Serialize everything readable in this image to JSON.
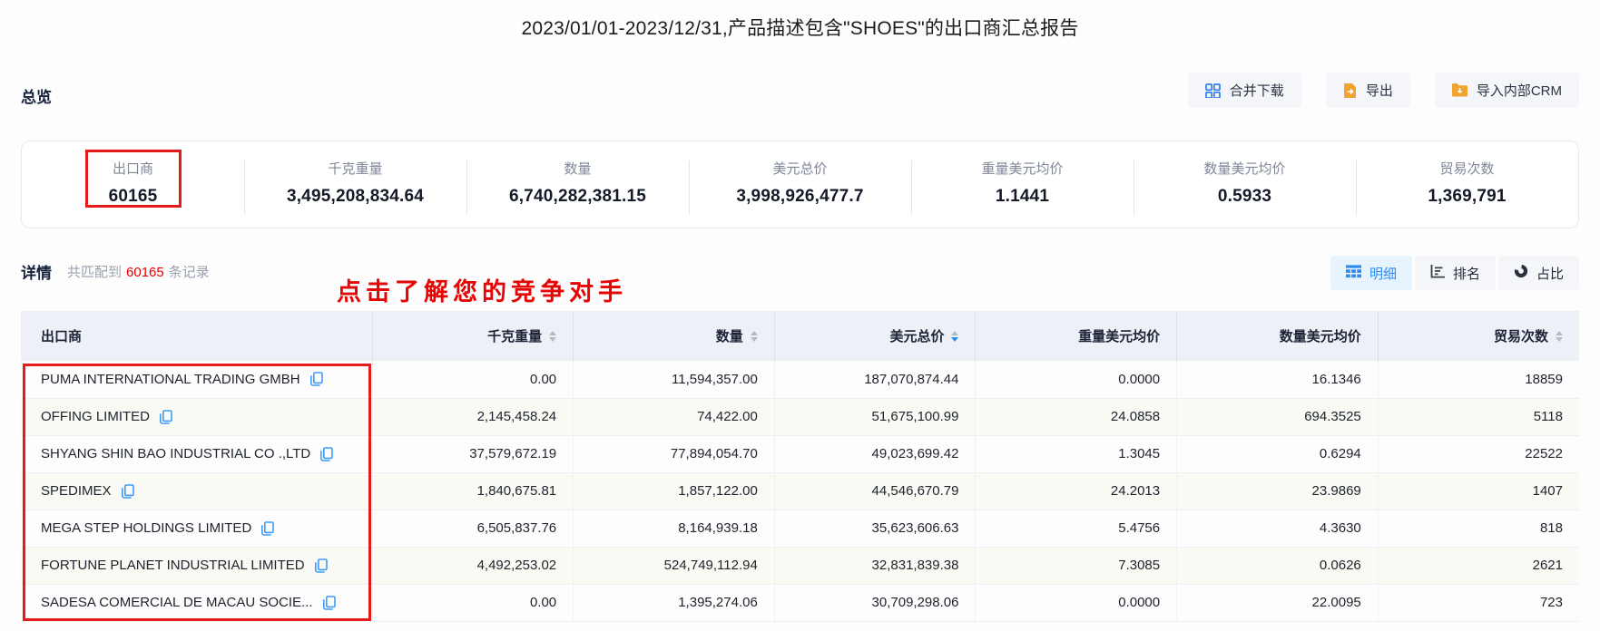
{
  "title": "2023/01/01-2023/12/31,产品描述包含\"SHOES\"的出口商汇总报告",
  "toolbar": {
    "merge_download": "合并下载",
    "export": "导出",
    "import_crm": "导入内部CRM"
  },
  "overview": {
    "heading": "总览",
    "stats": [
      {
        "label": "出口商",
        "value": "60165",
        "annotated": true
      },
      {
        "label": "千克重量",
        "value": "3,495,208,834.64"
      },
      {
        "label": "数量",
        "value": "6,740,282,381.15"
      },
      {
        "label": "美元总价",
        "value": "3,998,926,477.7"
      },
      {
        "label": "重量美元均价",
        "value": "1.1441"
      },
      {
        "label": "数量美元均价",
        "value": "0.5933"
      },
      {
        "label": "贸易次数",
        "value": "1,369,791"
      }
    ]
  },
  "detail": {
    "heading": "详情",
    "match_prefix": "共匹配到",
    "match_count": "60165",
    "match_suffix": "条记录",
    "annotation_text": "点击了解您的竞争对手",
    "views": [
      {
        "key": "detail",
        "label": "明细",
        "icon": "table-icon",
        "active": true
      },
      {
        "key": "ranking",
        "label": "排名",
        "icon": "ranking-icon",
        "active": false
      },
      {
        "key": "proportion",
        "label": "占比",
        "icon": "pie-icon",
        "active": false
      }
    ]
  },
  "table": {
    "columns": [
      {
        "key": "exporter",
        "label": "出口商",
        "align": "left",
        "sortable": false
      },
      {
        "key": "kg_weight",
        "label": "千克重量",
        "align": "right",
        "sortable": true,
        "sort": "none"
      },
      {
        "key": "quantity",
        "label": "数量",
        "align": "right",
        "sortable": true,
        "sort": "none"
      },
      {
        "key": "usd_total",
        "label": "美元总价",
        "align": "right",
        "sortable": true,
        "sort": "desc"
      },
      {
        "key": "usd_per_kg",
        "label": "重量美元均价",
        "align": "right",
        "sortable": false
      },
      {
        "key": "usd_per_qty",
        "label": "数量美元均价",
        "align": "right",
        "sortable": false
      },
      {
        "key": "trade_count",
        "label": "贸易次数",
        "align": "right",
        "sortable": true,
        "sort": "none"
      }
    ],
    "rows": [
      {
        "exporter": "PUMA INTERNATIONAL TRADING GMBH",
        "kg_weight": "0.00",
        "quantity": "11,594,357.00",
        "usd_total": "187,070,874.44",
        "usd_per_kg": "0.0000",
        "usd_per_qty": "16.1346",
        "trade_count": "18859"
      },
      {
        "exporter": "OFFING LIMITED",
        "kg_weight": "2,145,458.24",
        "quantity": "74,422.00",
        "usd_total": "51,675,100.99",
        "usd_per_kg": "24.0858",
        "usd_per_qty": "694.3525",
        "trade_count": "5118"
      },
      {
        "exporter": "SHYANG SHIN BAO INDUSTRIAL CO .,LTD",
        "kg_weight": "37,579,672.19",
        "quantity": "77,894,054.70",
        "usd_total": "49,023,699.42",
        "usd_per_kg": "1.3045",
        "usd_per_qty": "0.6294",
        "trade_count": "22522"
      },
      {
        "exporter": "SPEDIMEX",
        "kg_weight": "1,840,675.81",
        "quantity": "1,857,122.00",
        "usd_total": "44,546,670.79",
        "usd_per_kg": "24.2013",
        "usd_per_qty": "23.9869",
        "trade_count": "1407"
      },
      {
        "exporter": "MEGA STEP HOLDINGS LIMITED",
        "kg_weight": "6,505,837.76",
        "quantity": "8,164,939.18",
        "usd_total": "35,623,606.63",
        "usd_per_kg": "5.4756",
        "usd_per_qty": "4.3630",
        "trade_count": "818"
      },
      {
        "exporter": "FORTUNE PLANET INDUSTRIAL LIMITED",
        "kg_weight": "4,492,253.02",
        "quantity": "524,749,112.94",
        "usd_total": "32,831,839.38",
        "usd_per_kg": "7.3085",
        "usd_per_qty": "0.0626",
        "trade_count": "2621"
      },
      {
        "exporter": "SADESA COMERCIAL DE MACAU SOCIE...",
        "kg_weight": "0.00",
        "quantity": "1,395,274.06",
        "usd_total": "30,709,298.06",
        "usd_per_kg": "0.0000",
        "usd_per_qty": "22.0095",
        "trade_count": "723"
      }
    ]
  },
  "colors": {
    "accent_blue": "#2d8cf0",
    "icon_orange": "#f0a32f",
    "annotation_red": "#e31b1b",
    "count_red": "#e60000",
    "header_bg": "#edf0f7",
    "button_bg": "#f4f6f9",
    "active_view_bg": "#e7f3fd"
  }
}
